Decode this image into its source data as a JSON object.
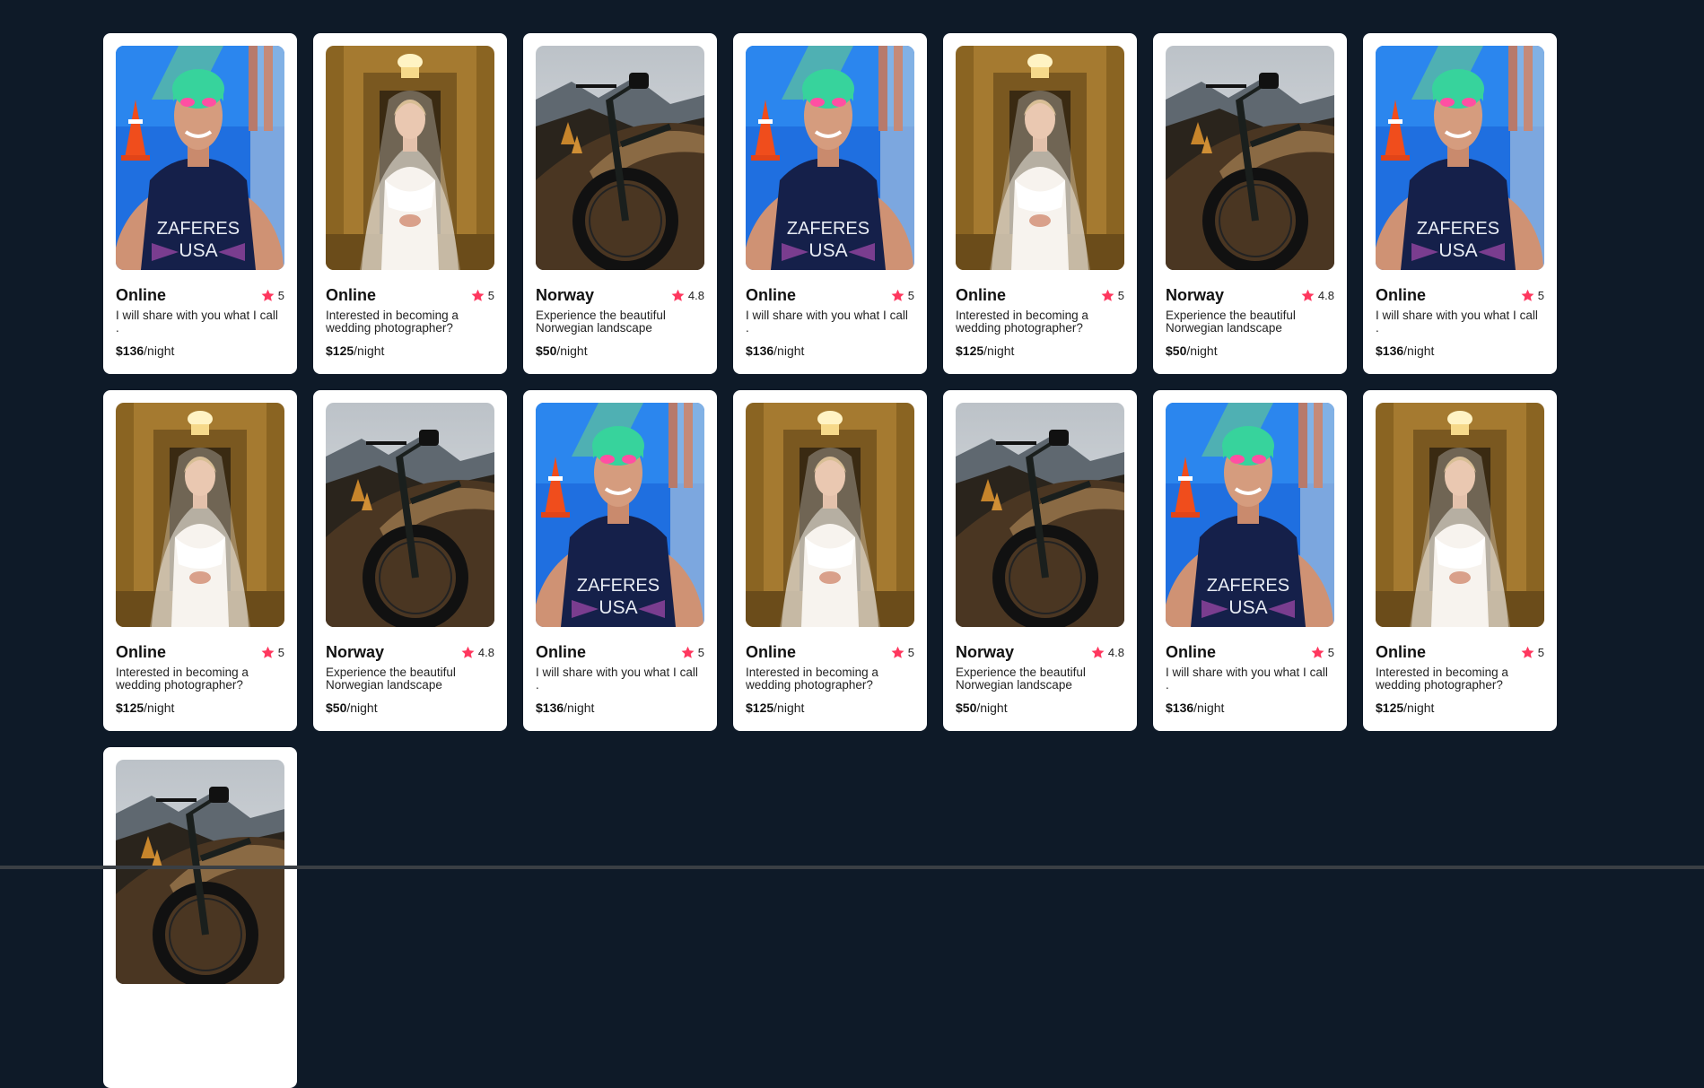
{
  "listings": [
    {
      "photo": "swimmer",
      "location": "Online",
      "rating": "5",
      "description": "I will share with you what I call .",
      "price": "$136",
      "unit": "/night"
    },
    {
      "photo": "bride",
      "location": "Online",
      "rating": "5",
      "description": "Interested in becoming a wedding photographer?",
      "price": "$125",
      "unit": "/night"
    },
    {
      "photo": "bike",
      "location": "Norway",
      "rating": "4.8",
      "description": "Experience the beautiful Norwegian landscape",
      "price": "$50",
      "unit": "/night"
    },
    {
      "photo": "swimmer",
      "location": "Online",
      "rating": "5",
      "description": "I will share with you what I call .",
      "price": "$136",
      "unit": "/night"
    },
    {
      "photo": "bride",
      "location": "Online",
      "rating": "5",
      "description": "Interested in becoming a wedding photographer?",
      "price": "$125",
      "unit": "/night"
    },
    {
      "photo": "bike",
      "location": "Norway",
      "rating": "4.8",
      "description": "Experience the beautiful Norwegian landscape",
      "price": "$50",
      "unit": "/night"
    },
    {
      "photo": "swimmer",
      "location": "Online",
      "rating": "5",
      "description": "I will share with you what I call .",
      "price": "$136",
      "unit": "/night"
    },
    {
      "photo": "bride",
      "location": "Online",
      "rating": "5",
      "description": "Interested in becoming a wedding photographer?",
      "price": "$125",
      "unit": "/night"
    },
    {
      "photo": "bike",
      "location": "Norway",
      "rating": "4.8",
      "description": "Experience the beautiful Norwegian landscape",
      "price": "$50",
      "unit": "/night"
    },
    {
      "photo": "swimmer",
      "location": "Online",
      "rating": "5",
      "description": "I will share with you what I call .",
      "price": "$136",
      "unit": "/night"
    },
    {
      "photo": "bride",
      "location": "Online",
      "rating": "5",
      "description": "Interested in becoming a wedding photographer?",
      "price": "$125",
      "unit": "/night"
    },
    {
      "photo": "bike",
      "location": "Norway",
      "rating": "4.8",
      "description": "Experience the beautiful Norwegian landscape",
      "price": "$50",
      "unit": "/night"
    },
    {
      "photo": "swimmer",
      "location": "Online",
      "rating": "5",
      "description": "I will share with you what I call .",
      "price": "$136",
      "unit": "/night"
    },
    {
      "photo": "bride",
      "location": "Online",
      "rating": "5",
      "description": "Interested in becoming a wedding photographer?",
      "price": "$125",
      "unit": "/night"
    },
    {
      "photo": "bike",
      "location": "",
      "rating": "",
      "description": "",
      "price": "",
      "unit": ""
    }
  ],
  "colors": {
    "background": "#0e1a28",
    "card": "#ffffff",
    "star": "#fe375e"
  },
  "icons": {
    "star": "star-icon"
  }
}
